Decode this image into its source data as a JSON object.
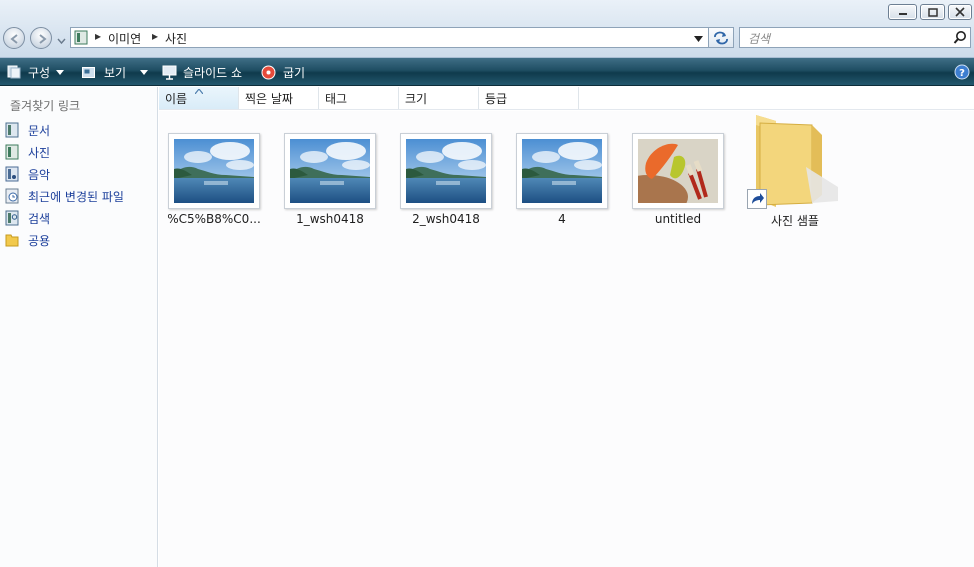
{
  "window": {
    "buttons": {
      "minimize_icon": "minimize-icon",
      "maximize_icon": "maximize-icon",
      "close_icon": "close-icon"
    }
  },
  "address": {
    "path": [
      "이미연",
      "사진"
    ]
  },
  "search": {
    "placeholder": "검색"
  },
  "toolbar": {
    "organize": "구성",
    "views": "보기",
    "slideshow": "슬라이드 쇼",
    "burn": "굽기"
  },
  "sidebar": {
    "header": "즐겨찾기 링크",
    "items": [
      {
        "label": "문서",
        "icon": "documents-icon"
      },
      {
        "label": "사진",
        "icon": "pictures-icon"
      },
      {
        "label": "음악",
        "icon": "music-icon"
      },
      {
        "label": "최근에 변경된 파일",
        "icon": "recent-files-icon"
      },
      {
        "label": "검색",
        "icon": "search-folder-icon"
      },
      {
        "label": "공용",
        "icon": "public-folder-icon"
      }
    ]
  },
  "columns": [
    "이름",
    "찍은 날짜",
    "태그",
    "크기",
    "등급"
  ],
  "files": [
    {
      "name": "%C5%B8%C0...",
      "type": "image"
    },
    {
      "name": "1_wsh0418",
      "type": "image"
    },
    {
      "name": "2_wsh0418",
      "type": "image"
    },
    {
      "name": "4",
      "type": "image"
    },
    {
      "name": "untitled",
      "type": "painting"
    },
    {
      "name": "사진 샘플",
      "type": "folder-shortcut"
    }
  ],
  "colors": {
    "command_bar": "#1f4e63",
    "link_text": "#1c3f9b"
  }
}
